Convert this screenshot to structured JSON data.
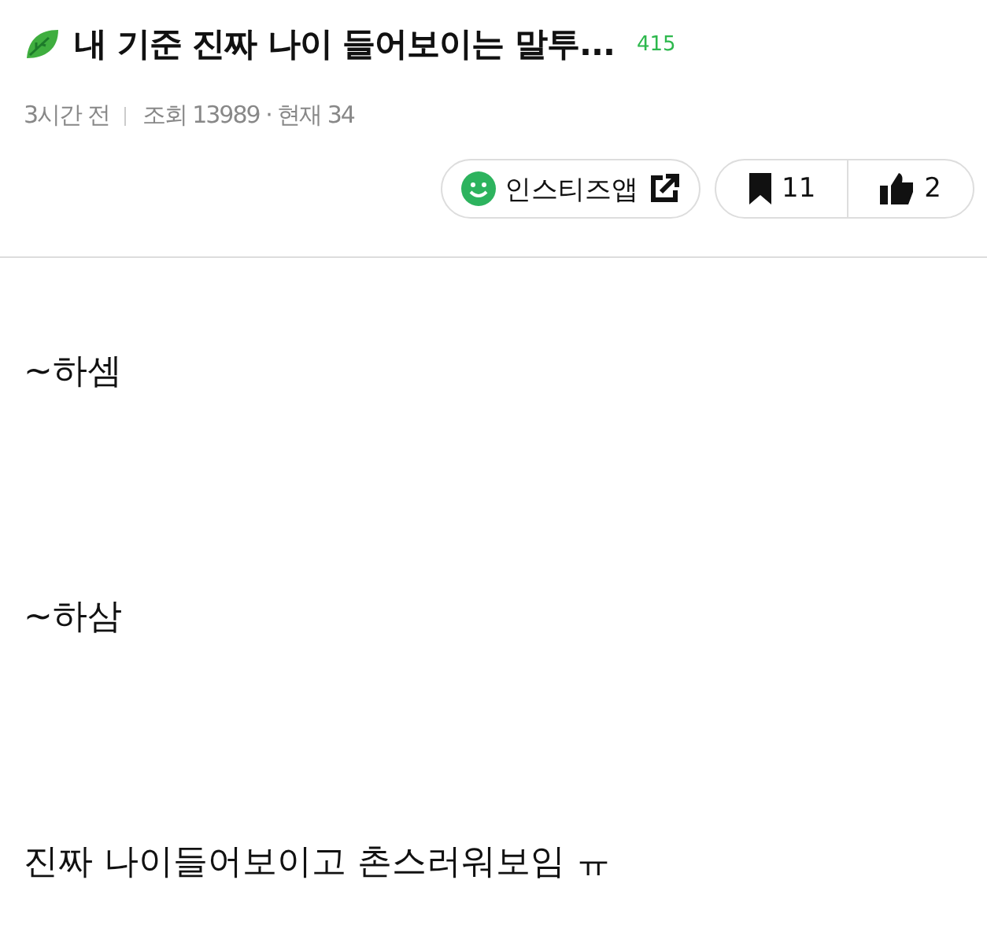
{
  "post": {
    "title": "내 기준 진짜 나이 들어보이는 말투...",
    "comment_count": "415",
    "time": "3시간 전",
    "views": "조회 13989 · 현재 34"
  },
  "actions": {
    "app_link": "인스티즈앱",
    "bookmarks": "11",
    "likes": "2"
  },
  "body": [
    "~하셈",
    "~하삼",
    "진짜 나이들어보이고 촌스러워보임 ㅠ"
  ]
}
